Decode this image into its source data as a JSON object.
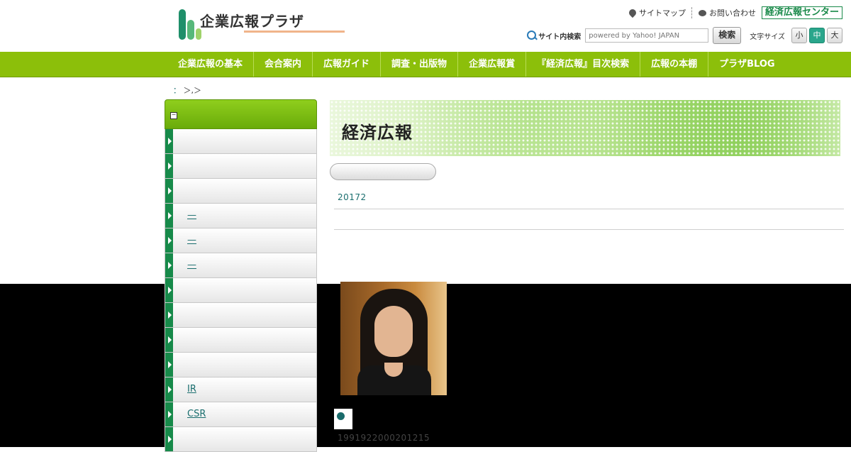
{
  "header": {
    "logo_text": "企業広報プラザ",
    "links": {
      "sitemap": "サイトマップ",
      "contact": "お問い合わせ",
      "center": "経済広報センター"
    },
    "search": {
      "label": "サイト内検索",
      "placeholder": "powered by Yahoo! JAPAN",
      "button": "検索"
    },
    "font_size": {
      "label": "文字サイズ",
      "small": "小",
      "medium": "中",
      "large": "大",
      "selected": "中"
    }
  },
  "nav": {
    "items": [
      {
        "label": "企業広報の基本"
      },
      {
        "label": "会合案内"
      },
      {
        "label": "広報ガイド"
      },
      {
        "label": "調査・出版物"
      },
      {
        "label": "企業広報賞"
      },
      {
        "label": "『経済広報』目次検索"
      },
      {
        "label": "広報の本棚"
      },
      {
        "label": "プラザBLOG"
      }
    ]
  },
  "breadcrumb": {
    "link": "：",
    "rest": "＞,＞"
  },
  "sidebar": {
    "toggle": "−",
    "items": [
      {
        "label": ""
      },
      {
        "label": ""
      },
      {
        "label": ""
      },
      {
        "label": "—"
      },
      {
        "label": "—"
      },
      {
        "label": "—"
      },
      {
        "label": ""
      },
      {
        "label": ""
      },
      {
        "label": ""
      },
      {
        "label": ""
      },
      {
        "label": "IR"
      },
      {
        "label": "CSR"
      },
      {
        "label": ""
      }
    ]
  },
  "main": {
    "banner_title": "経済広報",
    "date_link": "20172",
    "caption": "1991922000201215"
  },
  "colors": {
    "nav_green": "#8cbf0a",
    "accent_teal": "#1a6e6e",
    "side_stripe": "#178a4a"
  }
}
